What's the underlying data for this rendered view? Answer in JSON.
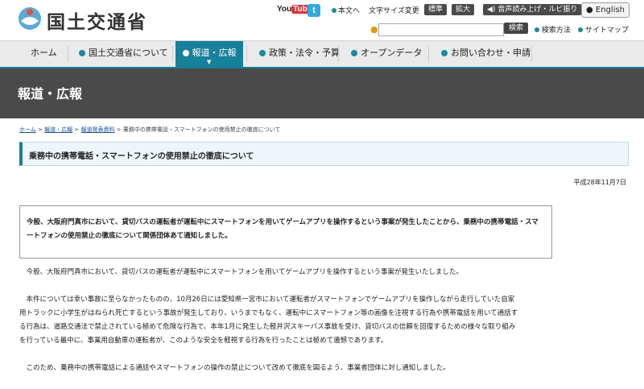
{
  "header": {
    "logo_text": "国土交通省",
    "youtube": {
      "you": "You",
      "tube": "Tube"
    },
    "twitter_glyph": "t",
    "text_only": "本文へ",
    "font_size_label": "文字サイズ変更",
    "font_standard": "標準",
    "font_large": "拡大",
    "read_aloud": "音声読み上げ・ルビ振り",
    "english": "English",
    "search_placeholder": "",
    "search_button": "検索",
    "search_method": "検索方法",
    "sitemap": "サイトマップ"
  },
  "nav": {
    "items": [
      {
        "label": "ホーム"
      },
      {
        "label": "国土交通省について"
      },
      {
        "label": "報道・広報"
      },
      {
        "label": "政策・法令・予算"
      },
      {
        "label": "オープンデータ"
      },
      {
        "label": "お問い合わせ・申請"
      }
    ],
    "active_caret": "▼"
  },
  "page": {
    "section_title": "報道・広報",
    "breadcrumb": [
      {
        "label": "ホーム"
      },
      {
        "label": "報道・広報"
      },
      {
        "label": "報道発表資料"
      },
      {
        "label": "乗務中の携帯電話・スマートフォンの使用禁止の徹底について"
      }
    ],
    "breadcrumb_sep": ">",
    "title": "乗務中の携帯電話・スマートフォンの使用禁止の徹底について",
    "date": "平成28年11月7日",
    "summary": "今般、大阪府門真市において、貸切バスの運転者が運転中にスマートフォンを用いてゲームアプリを操作するという事案が発生したことから、乗務中の携帯電話・スマートフォンの使用禁止の徹底について関係団体あて通知しました。",
    "paragraphs": [
      "今般、大阪府門真市において、貸切バスの運転者が運転中にスマートフォンを用いてゲームアプリを操作するという事案が発生いたしました。",
      "本件については幸い事故に至らなかったものの、10月26日には愛知県一宮市において運転者がスマートフォンでゲームアプリを操作しながら走行していた自家用トラックに小学生がはねられ死亡するという事故が発生しており、いうまでもなく、運転中にスマートフォン等の画像を注視する行為や携帯電話を用いて通話する行為は、道路交通法で禁止されている極めて危険な行為で、本年1月に発生した軽井沢スキーバス事故を受け、貸切バスの信頼を回復するための様々な取り組みを行っている最中に、事業用自動車の運転者が、このような安全を軽視する行為を行ったことは極めて遺憾であります。",
      "このため、乗務中の携帯電話による通話やスマートフォンの操作の禁止について改めて徹底を図るよう、事業者団体に対し通知しました。"
    ]
  }
}
